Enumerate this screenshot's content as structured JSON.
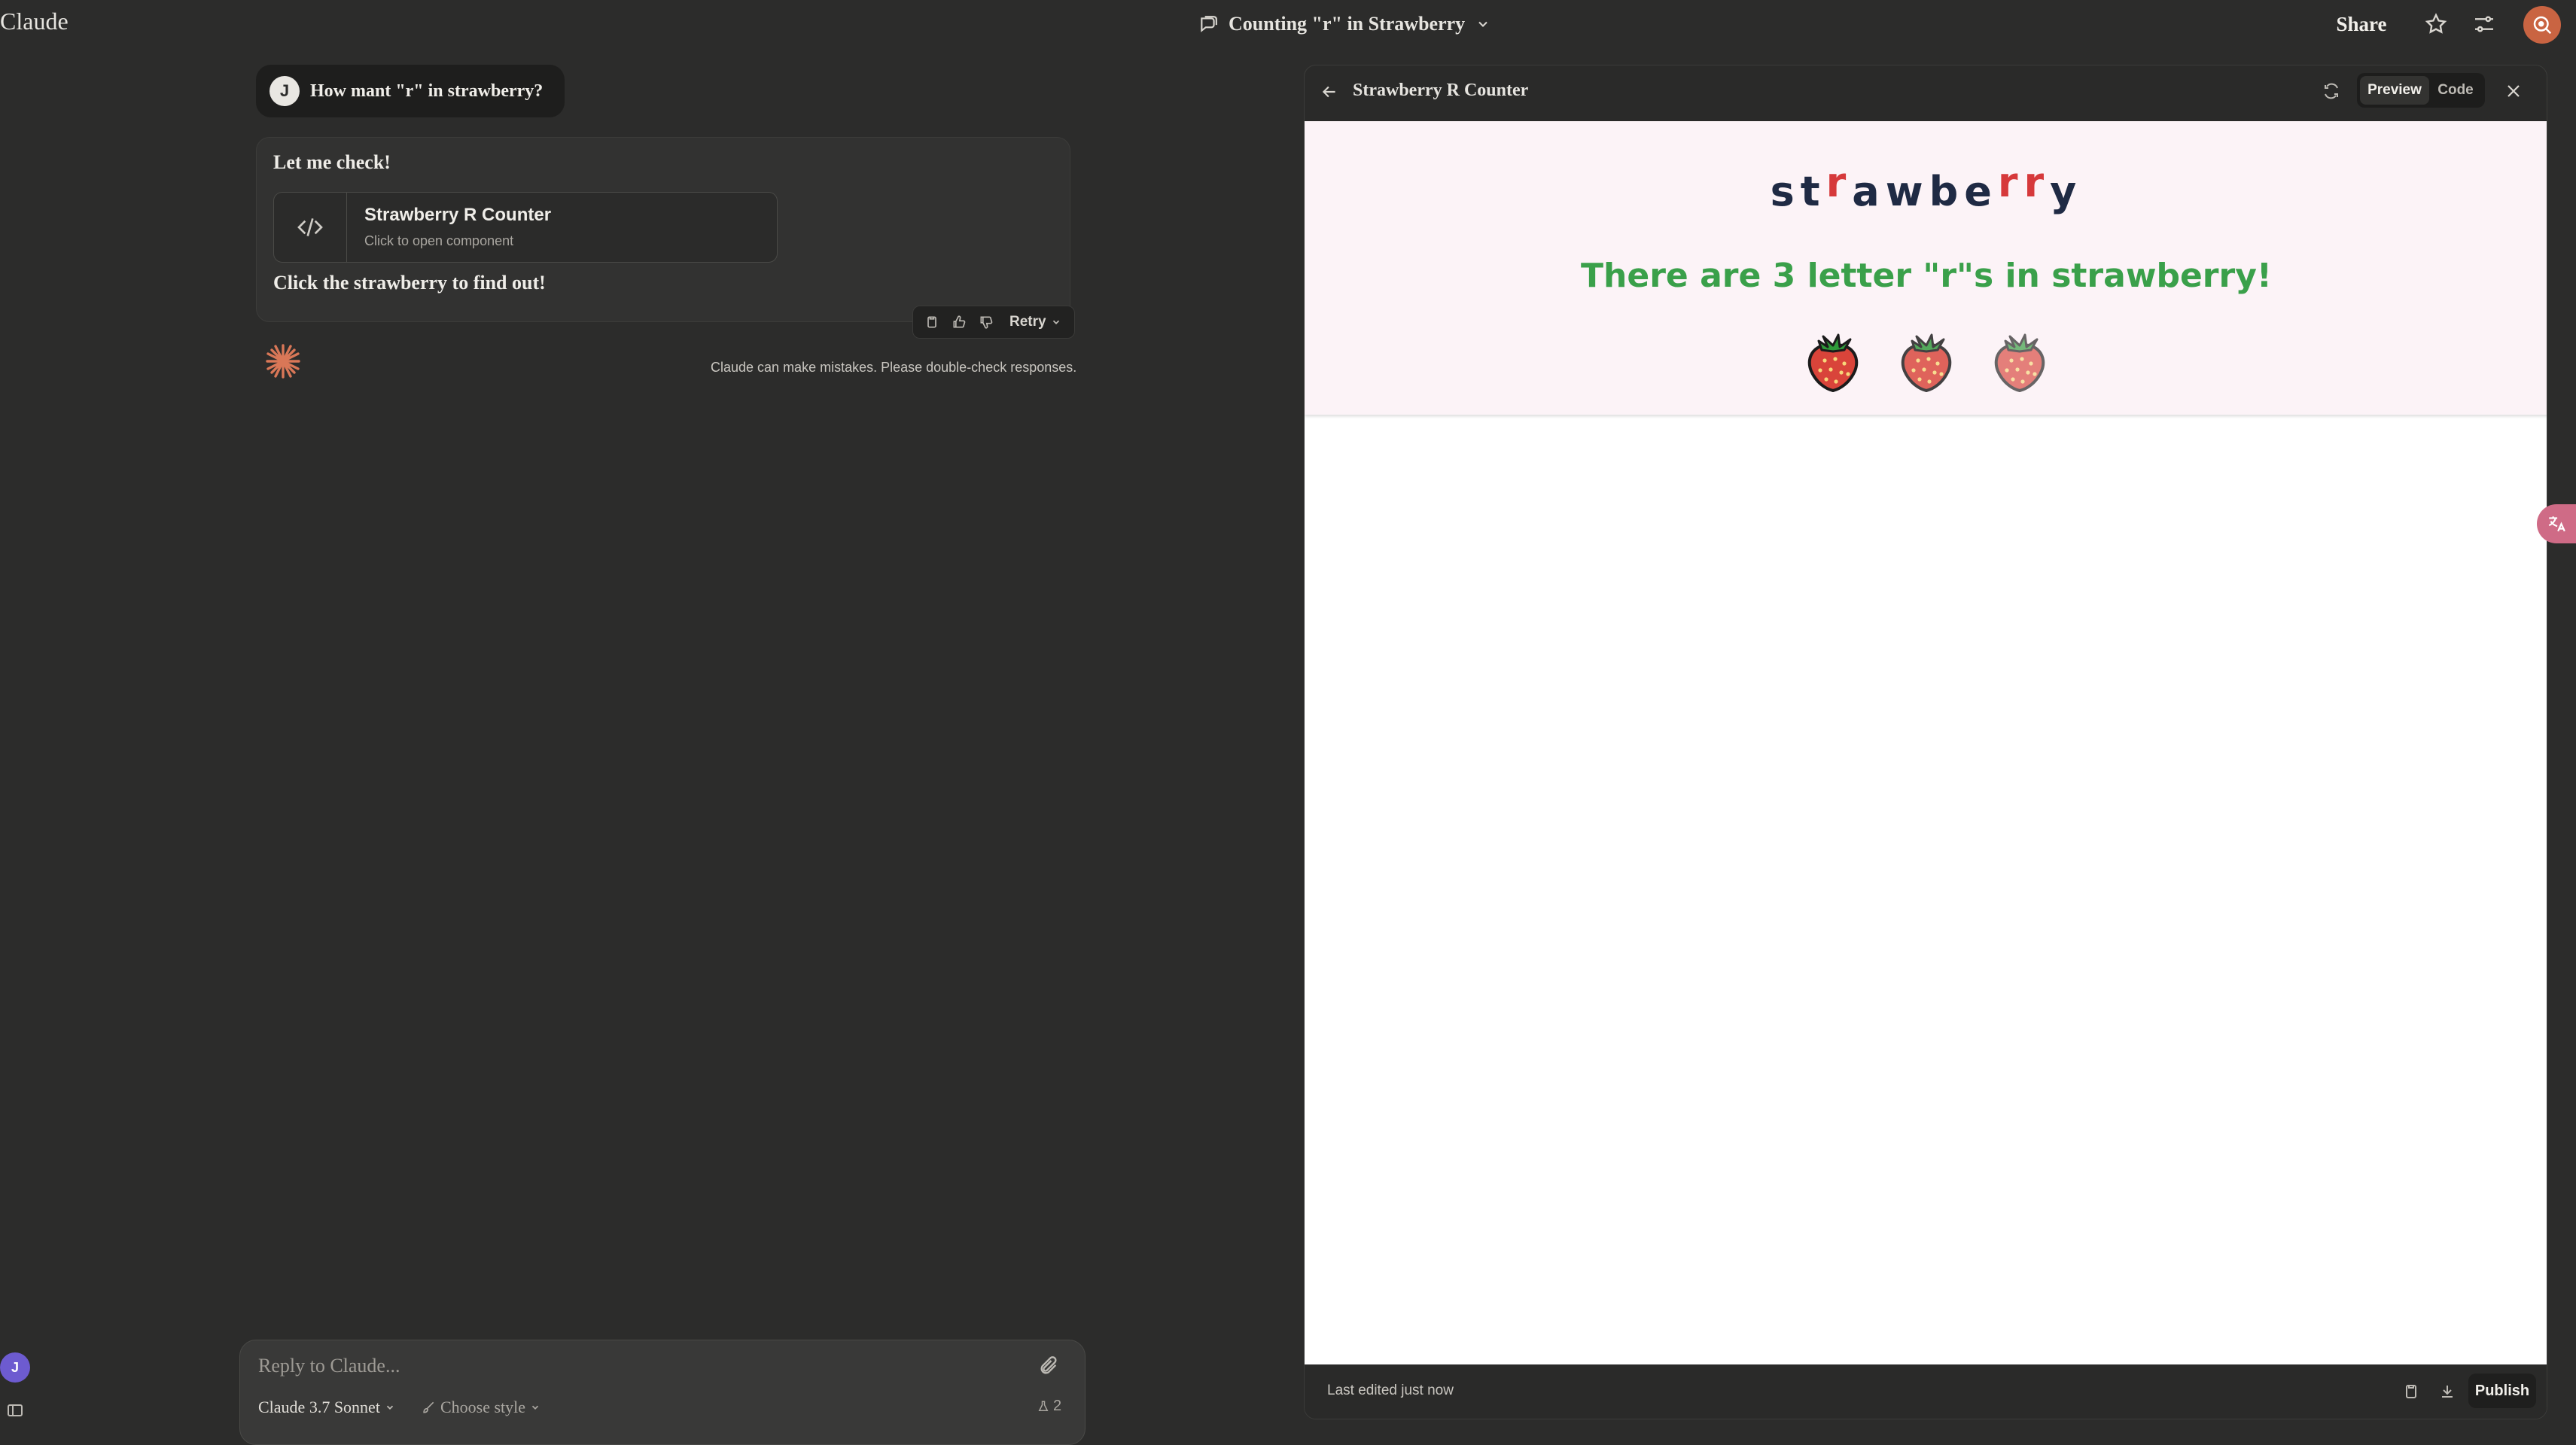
{
  "app": {
    "brand": "Claude"
  },
  "header": {
    "chat_title": "Counting \"r\" in Strawberry",
    "share_label": "Share"
  },
  "user_message": {
    "avatar_initial": "J",
    "text": "How mant \"r\" in strawberry?"
  },
  "assistant_message": {
    "intro": "Let me check!",
    "artifact_card": {
      "title": "Strawberry R Counter",
      "subtitle": "Click to open component"
    },
    "outro": "Click the strawberry to find out!",
    "retry_label": "Retry"
  },
  "disclaimer": "Claude can make mistakes. Please double-check responses.",
  "composer": {
    "placeholder": "Reply to Claude...",
    "model": "Claude 3.7 Sonnet",
    "style": "Choose style",
    "count": "2"
  },
  "rail": {
    "avatar_initial": "J"
  },
  "artifact_panel": {
    "title": "Strawberry R Counter",
    "tabs": [
      {
        "label": "Preview",
        "active": true
      },
      {
        "label": "Code",
        "active": false
      }
    ],
    "preview": {
      "word_letters": [
        "s",
        "t",
        "r",
        "a",
        "w",
        "b",
        "e",
        "r",
        "r",
        "y"
      ],
      "result": "There are 3 letter \"r\"s in strawberry!",
      "strawberry_count": 3
    },
    "footer": {
      "last_edited": "Last edited just now",
      "publish_label": "Publish"
    }
  },
  "colors": {
    "accent": "#c96442",
    "highlight_r": "#d6393b",
    "result_green": "#3aa04a",
    "background": "#2c2c2b"
  }
}
